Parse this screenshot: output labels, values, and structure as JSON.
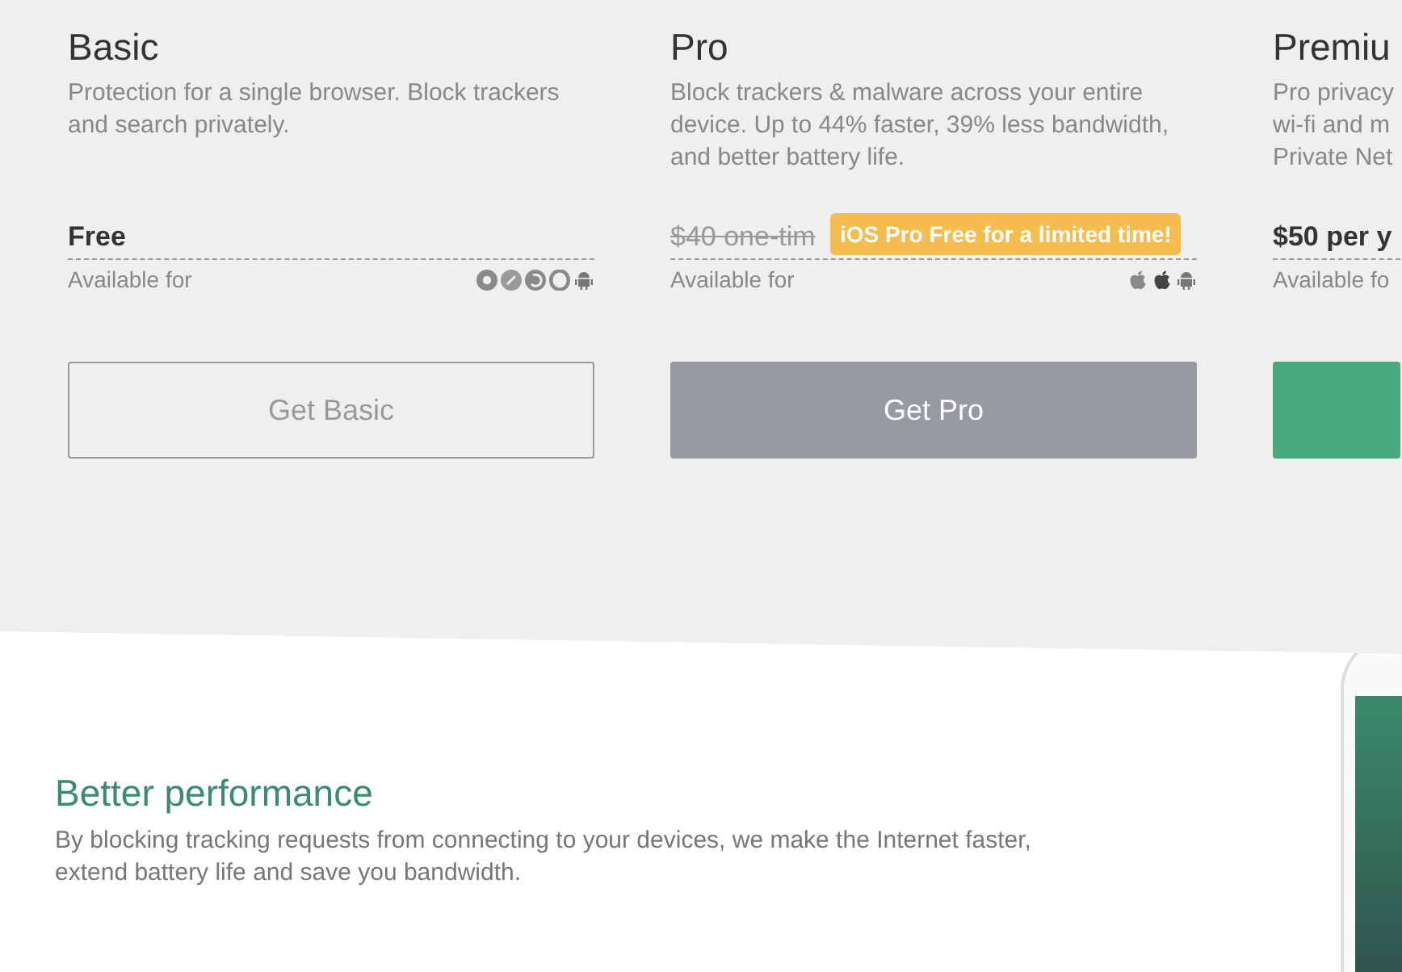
{
  "plans": [
    {
      "name": "Basic",
      "description": "Protection for a single browser. Block trackers and search privately.",
      "price": "Free",
      "strikethrough": false,
      "available_label": "Available for",
      "platforms": [
        {
          "kind": "chrome"
        },
        {
          "kind": "safari"
        },
        {
          "kind": "firefox"
        },
        {
          "kind": "opera"
        },
        {
          "kind": "android"
        }
      ],
      "button": {
        "label": "Get Basic",
        "kind": "outline"
      }
    },
    {
      "name": "Pro",
      "description": "Block trackers & malware across your entire device. Up to 44% faster, 39% less bandwidth, and better battery life.",
      "price": "$40 one-tim",
      "strikethrough": true,
      "badge": "iOS Pro Free for a limited time!",
      "available_label": "Available for",
      "platforms": [
        {
          "kind": "apple-light"
        },
        {
          "kind": "apple"
        },
        {
          "kind": "android"
        }
      ],
      "button": {
        "label": "Get Pro",
        "kind": "grey"
      }
    },
    {
      "name": "Premiu",
      "description_lines": [
        "Pro privacy",
        "wi-fi and m",
        "Private Net"
      ],
      "price": "$50 per y",
      "strikethrough": false,
      "available_label": "Available fo",
      "button": {
        "kind": "green"
      }
    }
  ],
  "feature": {
    "title": "Better performance",
    "text": "By blocking tracking requests from connecting to your devices, we make the Internet faster, extend battery life and save you bandwidth."
  }
}
